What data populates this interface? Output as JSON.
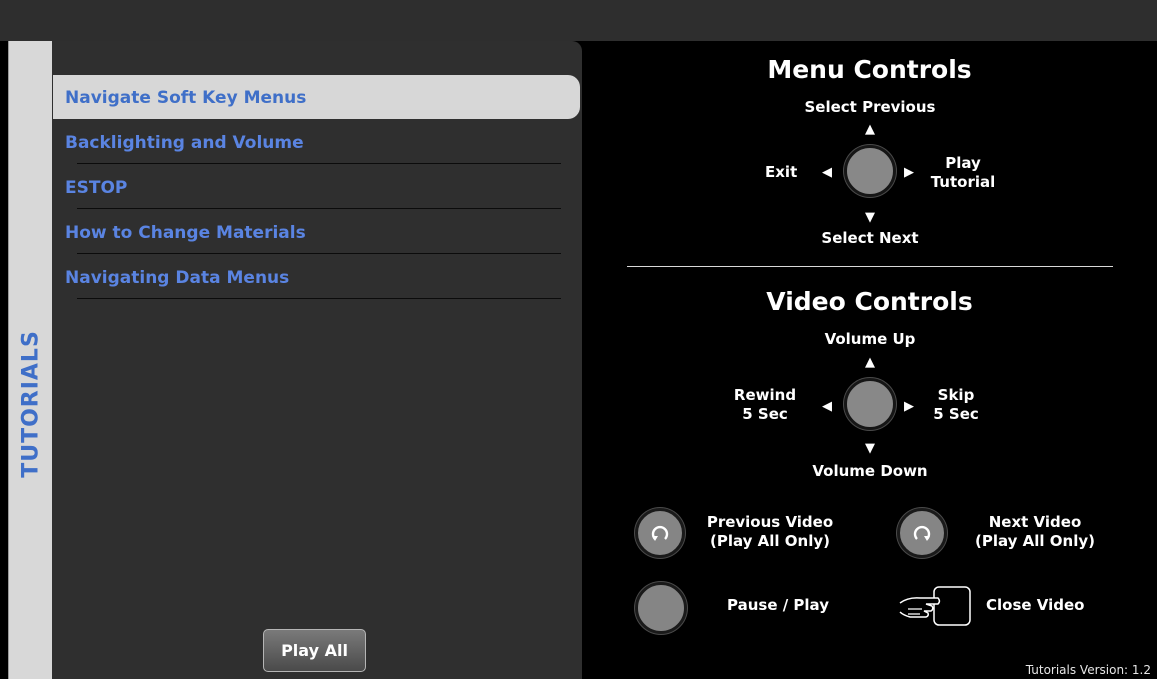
{
  "sidebar": {
    "tab_label": "TUTORIALS"
  },
  "tutorials": {
    "selected_index": 0,
    "items": [
      {
        "label": "Navigate Soft Key Menus"
      },
      {
        "label": "Backlighting and Volume"
      },
      {
        "label": "ESTOP"
      },
      {
        "label": "How to Change Materials"
      },
      {
        "label": "Navigating Data Menus"
      }
    ],
    "play_all_label": "Play All"
  },
  "menu_controls": {
    "title": "Menu Controls",
    "up": "Select Previous",
    "down": "Select Next",
    "left": "Exit",
    "right_line1": "Play",
    "right_line2": "Tutorial"
  },
  "video_controls": {
    "title": "Video Controls",
    "up": "Volume Up",
    "down": "Volume Down",
    "left_line1": "Rewind",
    "left_line2": "5 Sec",
    "right_line1": "Skip",
    "right_line2": "5 Sec"
  },
  "extra_controls": {
    "prev_line1": "Previous Video",
    "prev_line2": "(Play All Only)",
    "next_line1": "Next Video",
    "next_line2": "(Play All Only)",
    "pause_play": "Pause / Play",
    "close_video": "Close Video"
  },
  "footer": {
    "version": "Tutorials Version: 1.2"
  }
}
